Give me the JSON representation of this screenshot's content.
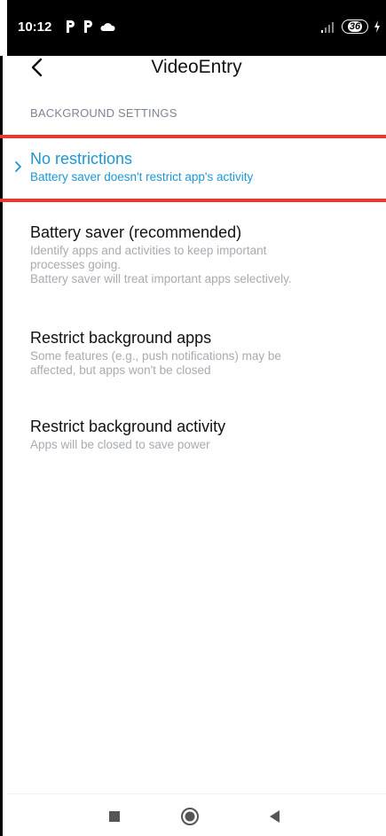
{
  "status_bar": {
    "time": "10:12",
    "left_icons": [
      "p-notification-icon",
      "p-notification-icon",
      "cloud-icon"
    ],
    "right_icons": [
      "signal-icon",
      "battery-icon",
      "charging-icon"
    ],
    "battery_level": "36"
  },
  "header": {
    "title": "VideoEntry",
    "back_icon": "back-arrow-icon"
  },
  "section": {
    "header": "BACKGROUND SETTINGS"
  },
  "options": [
    {
      "title": "No restrictions",
      "description": [
        "Battery saver doesn't restrict app's activity"
      ],
      "selected": true
    },
    {
      "title": "Battery saver (recommended)",
      "description": [
        "Identify apps and activities to keep important",
        "processes going.",
        "Battery saver will treat important apps selectively."
      ],
      "selected": false
    },
    {
      "title": "Restrict background apps",
      "description": [
        "Some features (e.g., push notifications) may be",
        "affected, but apps won't be closed"
      ],
      "selected": false
    },
    {
      "title": "Restrict background activity",
      "description": [
        "Apps will be closed to save power"
      ],
      "selected": false
    }
  ],
  "nav_bar": {
    "buttons": [
      "recents-square-icon",
      "home-circle-icon",
      "back-triangle-icon"
    ]
  },
  "colors": {
    "accent": "#1d97d4",
    "highlight_border": "#e23b32",
    "secondary_text": "#a7abb1",
    "section_header": "#7d8593"
  }
}
